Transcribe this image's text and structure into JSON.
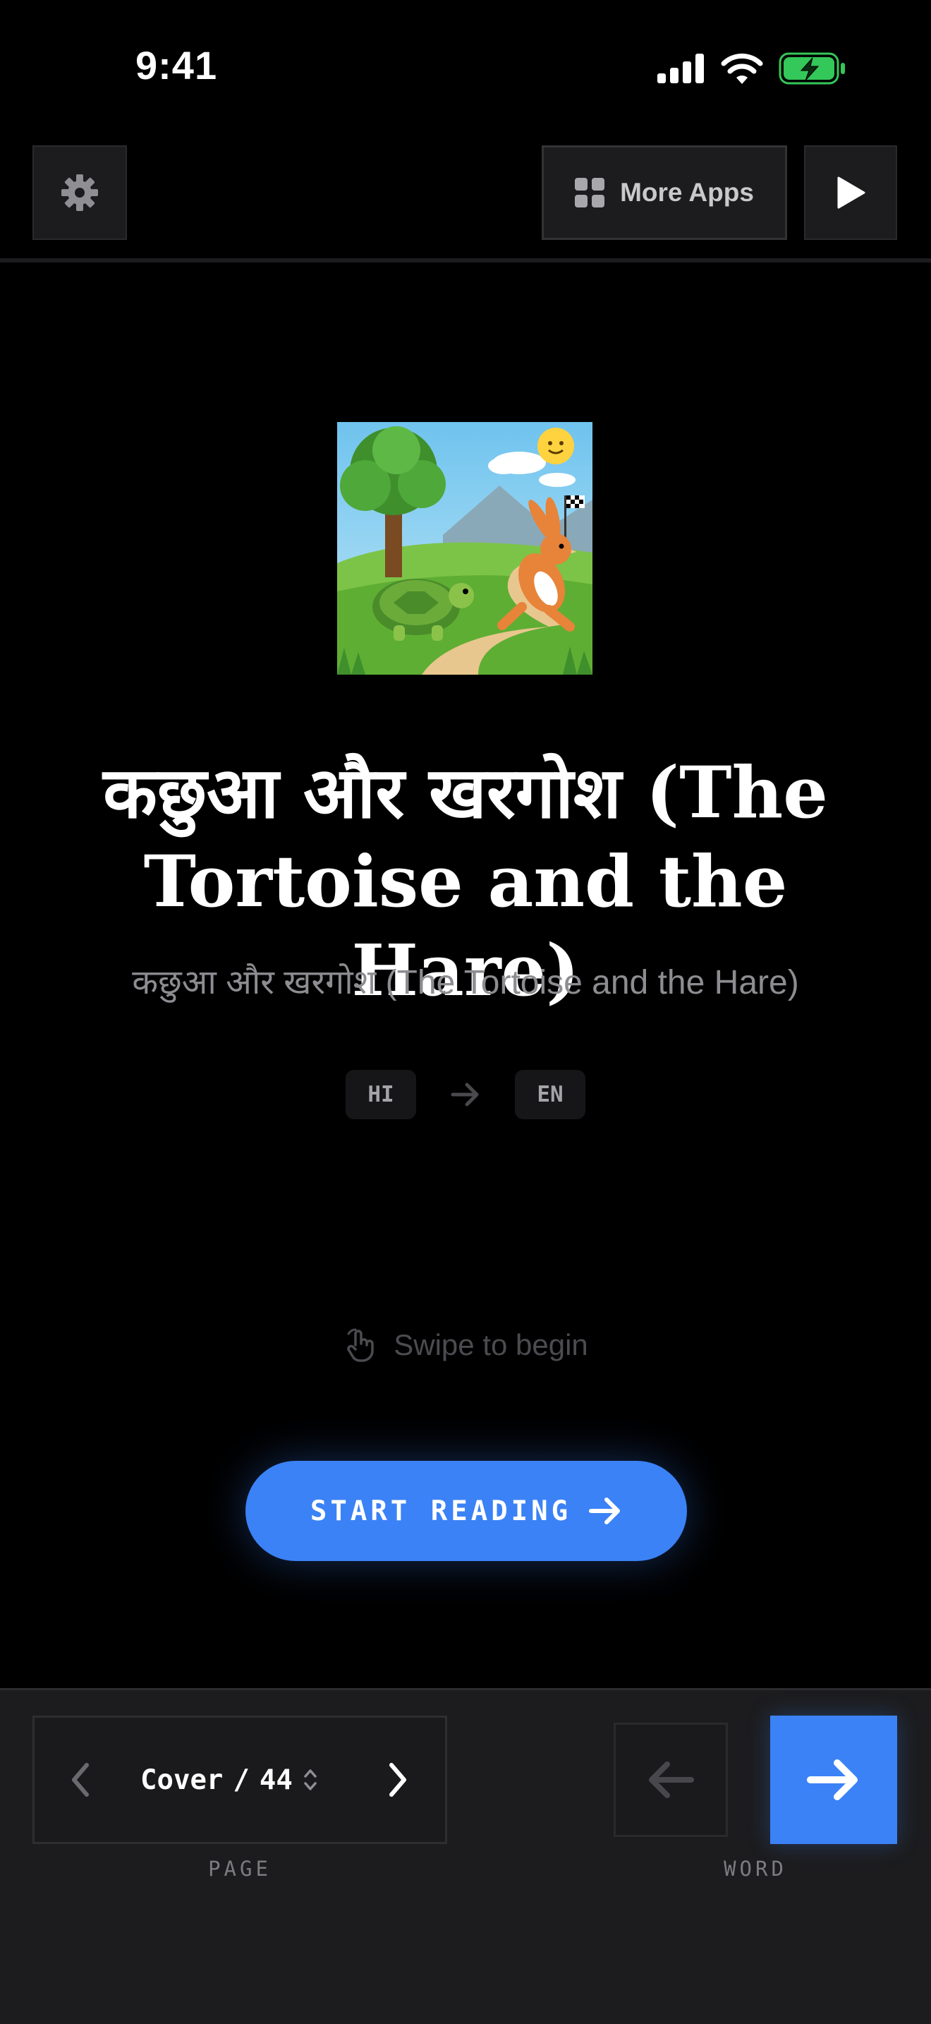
{
  "status_bar": {
    "time": "9:41"
  },
  "toolbar": {
    "more_apps_label": "More Apps"
  },
  "cover": {
    "title": "कछुआ और खरगोश (The Tortoise and the Hare)",
    "subtitle": "कछुआ और खरगोश (The Tortoise and the Hare)",
    "source_lang": "HI",
    "target_lang": "EN",
    "swipe_hint": "Swipe to begin",
    "start_button_label": "START READING"
  },
  "navigation": {
    "page_current": "Cover",
    "page_separator": "/",
    "page_total": "44",
    "page_label": "PAGE",
    "word_label": "WORD"
  },
  "colors": {
    "accent": "#3b82f6",
    "panel": "#1c1c1e",
    "battery": "#34c759"
  },
  "icons": [
    "signal-icon",
    "wifi-icon",
    "battery-charging-icon",
    "gear-icon",
    "grid-icon",
    "play-icon",
    "arrow-right-icon",
    "hand-swipe-icon",
    "chevron-left-icon",
    "chevron-right-icon",
    "chevron-updown-icon",
    "arrow-left-icon"
  ]
}
